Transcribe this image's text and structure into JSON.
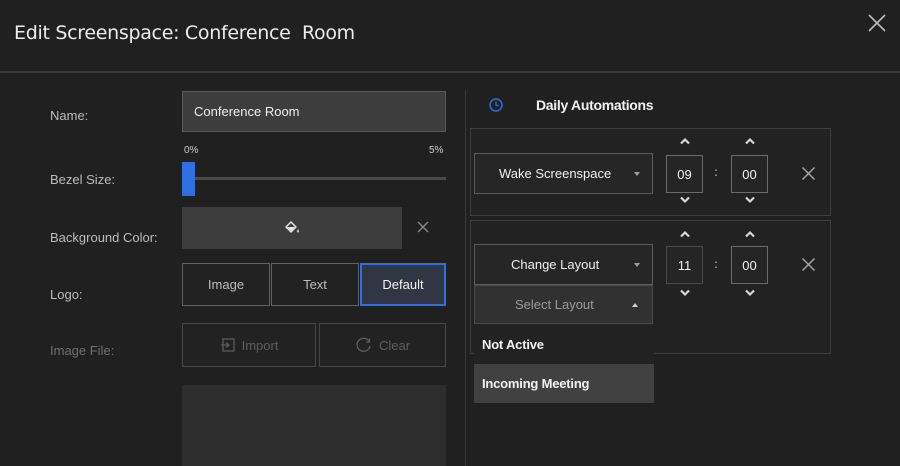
{
  "header": {
    "title": "Edit Screenspace: Conference  Room"
  },
  "form": {
    "name_label": "Name:",
    "name_value": "Conference Room",
    "bezel_label": "Bezel Size:",
    "bezel_min": "0%",
    "bezel_max": "5%",
    "bezel_value_fraction": 0.0,
    "background_label": "Background Color:",
    "logo_label": "Logo:",
    "logo_options": [
      "Image",
      "Text",
      "Default"
    ],
    "logo_selected": "Default",
    "image_file_label": "Image File:",
    "import_label": "Import",
    "clear_label": "Clear"
  },
  "automations": {
    "title": "Daily Automations",
    "rows": [
      {
        "action": "Wake Screenspace",
        "hour": "09",
        "minute": "00"
      },
      {
        "action": "Change Layout",
        "hour": "11",
        "minute": "00",
        "layout_placeholder": "Select Layout"
      }
    ],
    "dropdown_options": [
      "Not Active",
      "Incoming Meeting"
    ],
    "hovered_option": "Incoming Meeting"
  },
  "colors": {
    "accent": "#2f6fe0",
    "background": "#202020",
    "hover": "#414141"
  }
}
